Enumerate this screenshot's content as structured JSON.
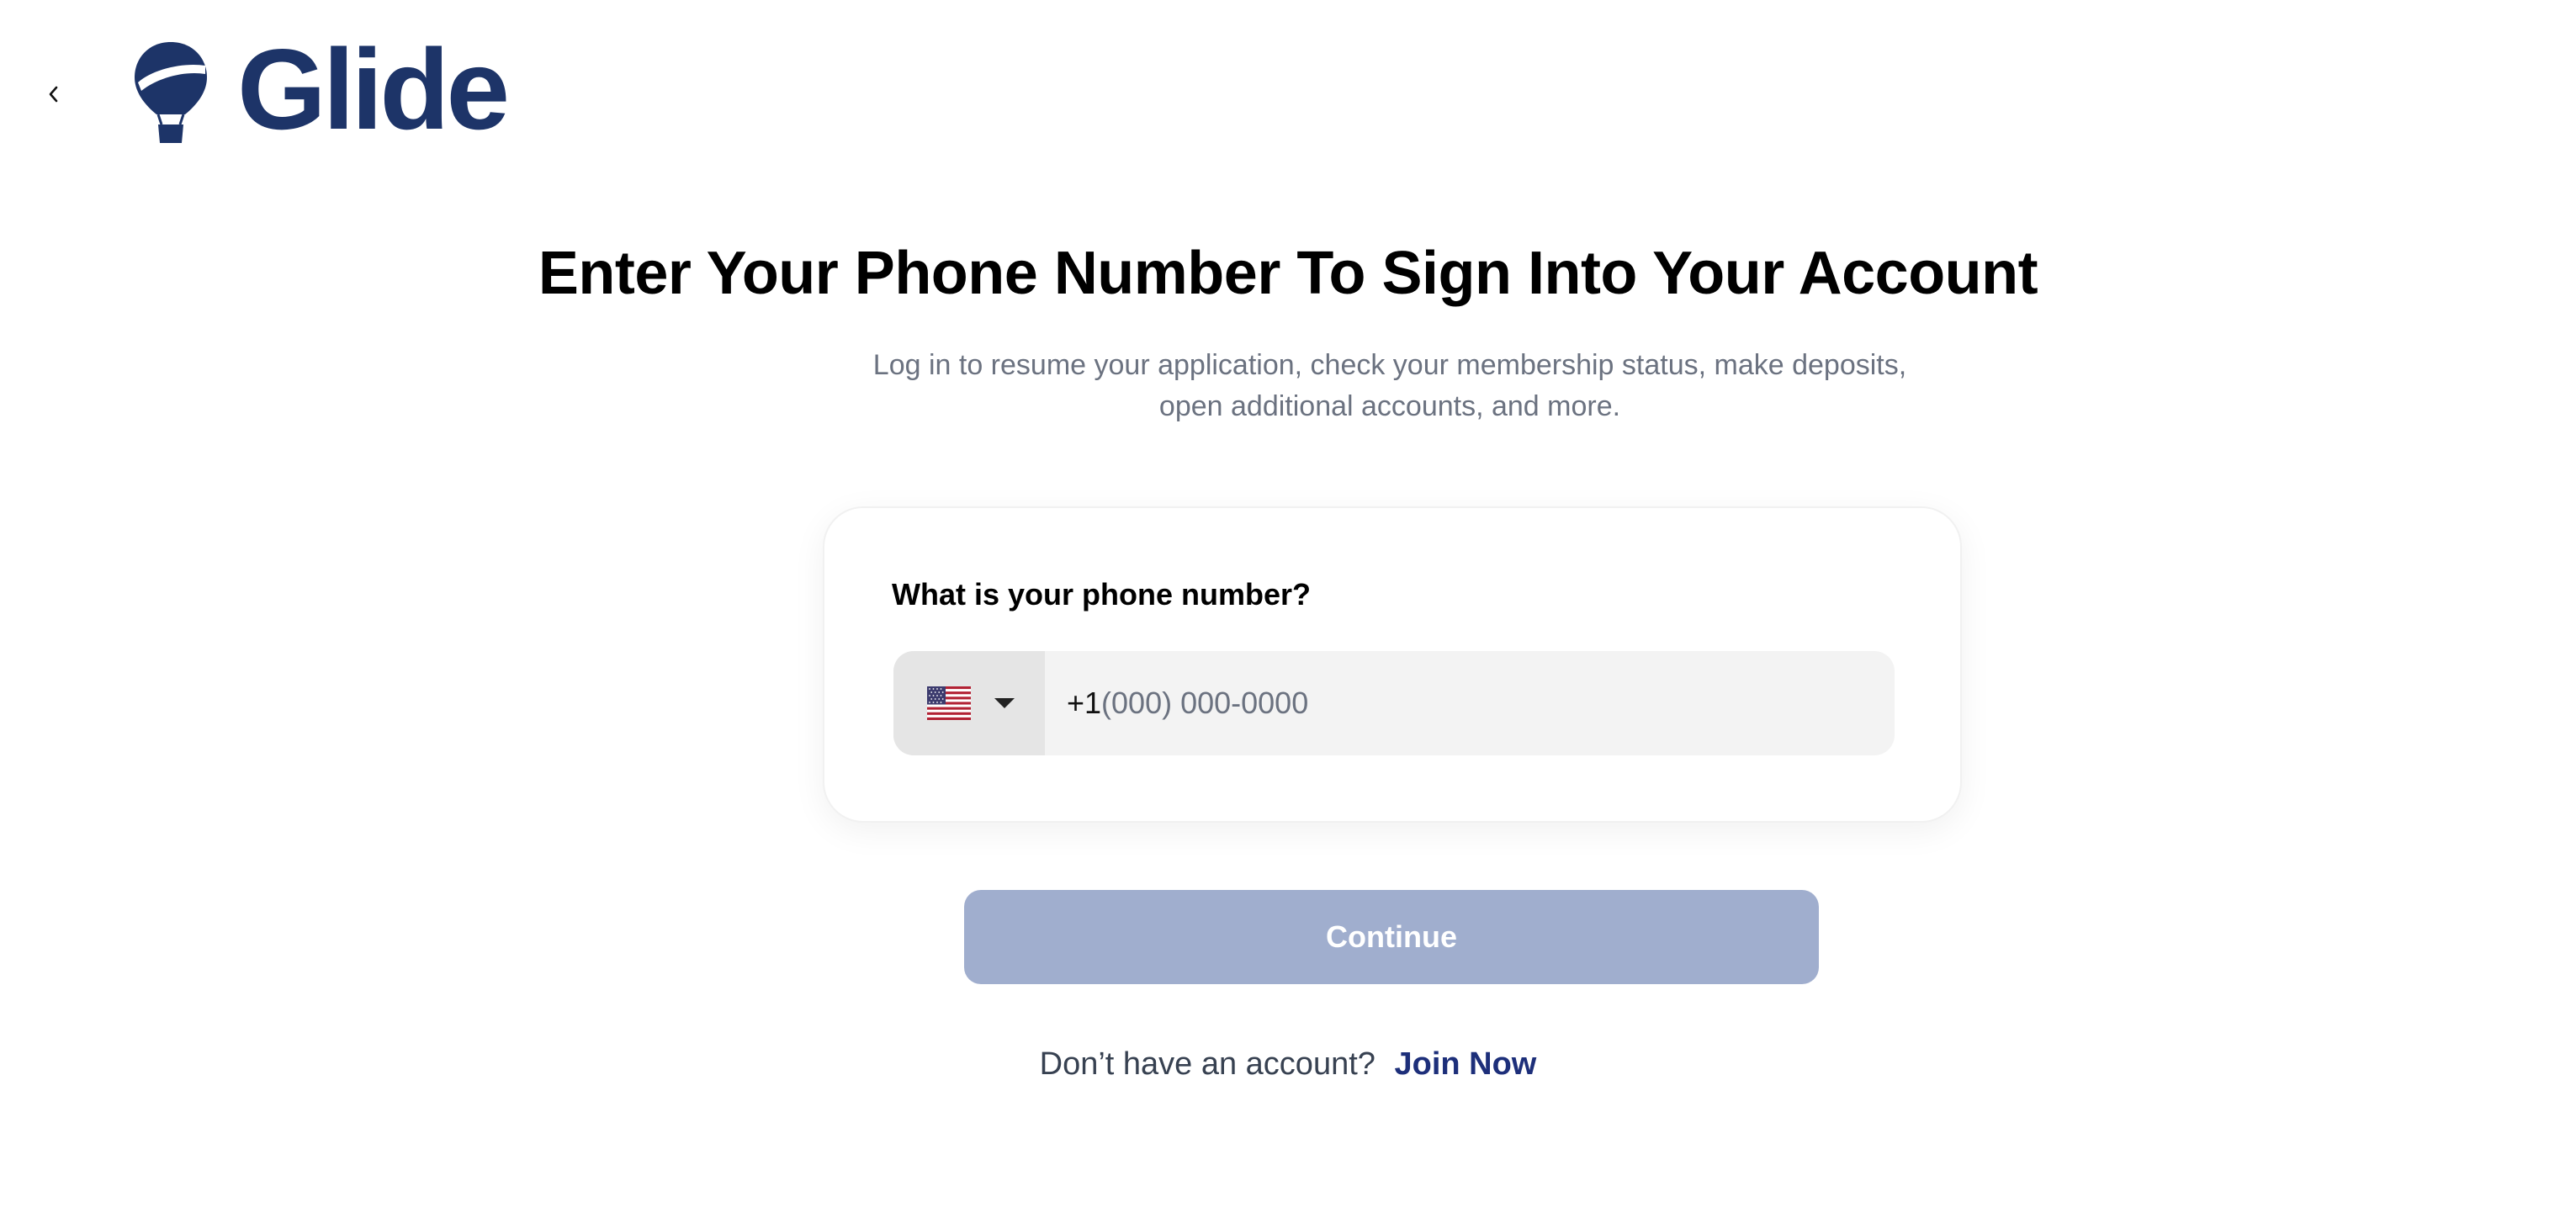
{
  "header": {
    "back_icon": "chevron-left-icon",
    "logo_text": "Glide",
    "logo_icon": "hot-air-balloon-icon"
  },
  "main": {
    "title": "Enter Your Phone Number To Sign Into Your Account",
    "subtitle": "Log in to resume your application, check your membership status, make deposits, open additional accounts, and more."
  },
  "phone_card": {
    "label": "What is your phone number?",
    "country": {
      "selected_flag_icon": "us-flag-icon",
      "caret_icon": "caret-down-icon"
    },
    "dial_code": "+1",
    "input_value": "",
    "placeholder": "(000) 000-0000"
  },
  "actions": {
    "continue_label": "Continue",
    "signup_prompt": "Don’t have an account?",
    "join_label": "Join Now"
  },
  "colors": {
    "brand": "#1d3468",
    "continue_disabled": "#a0aece",
    "link": "#1d2f7a",
    "subtitle": "#6b7280"
  }
}
